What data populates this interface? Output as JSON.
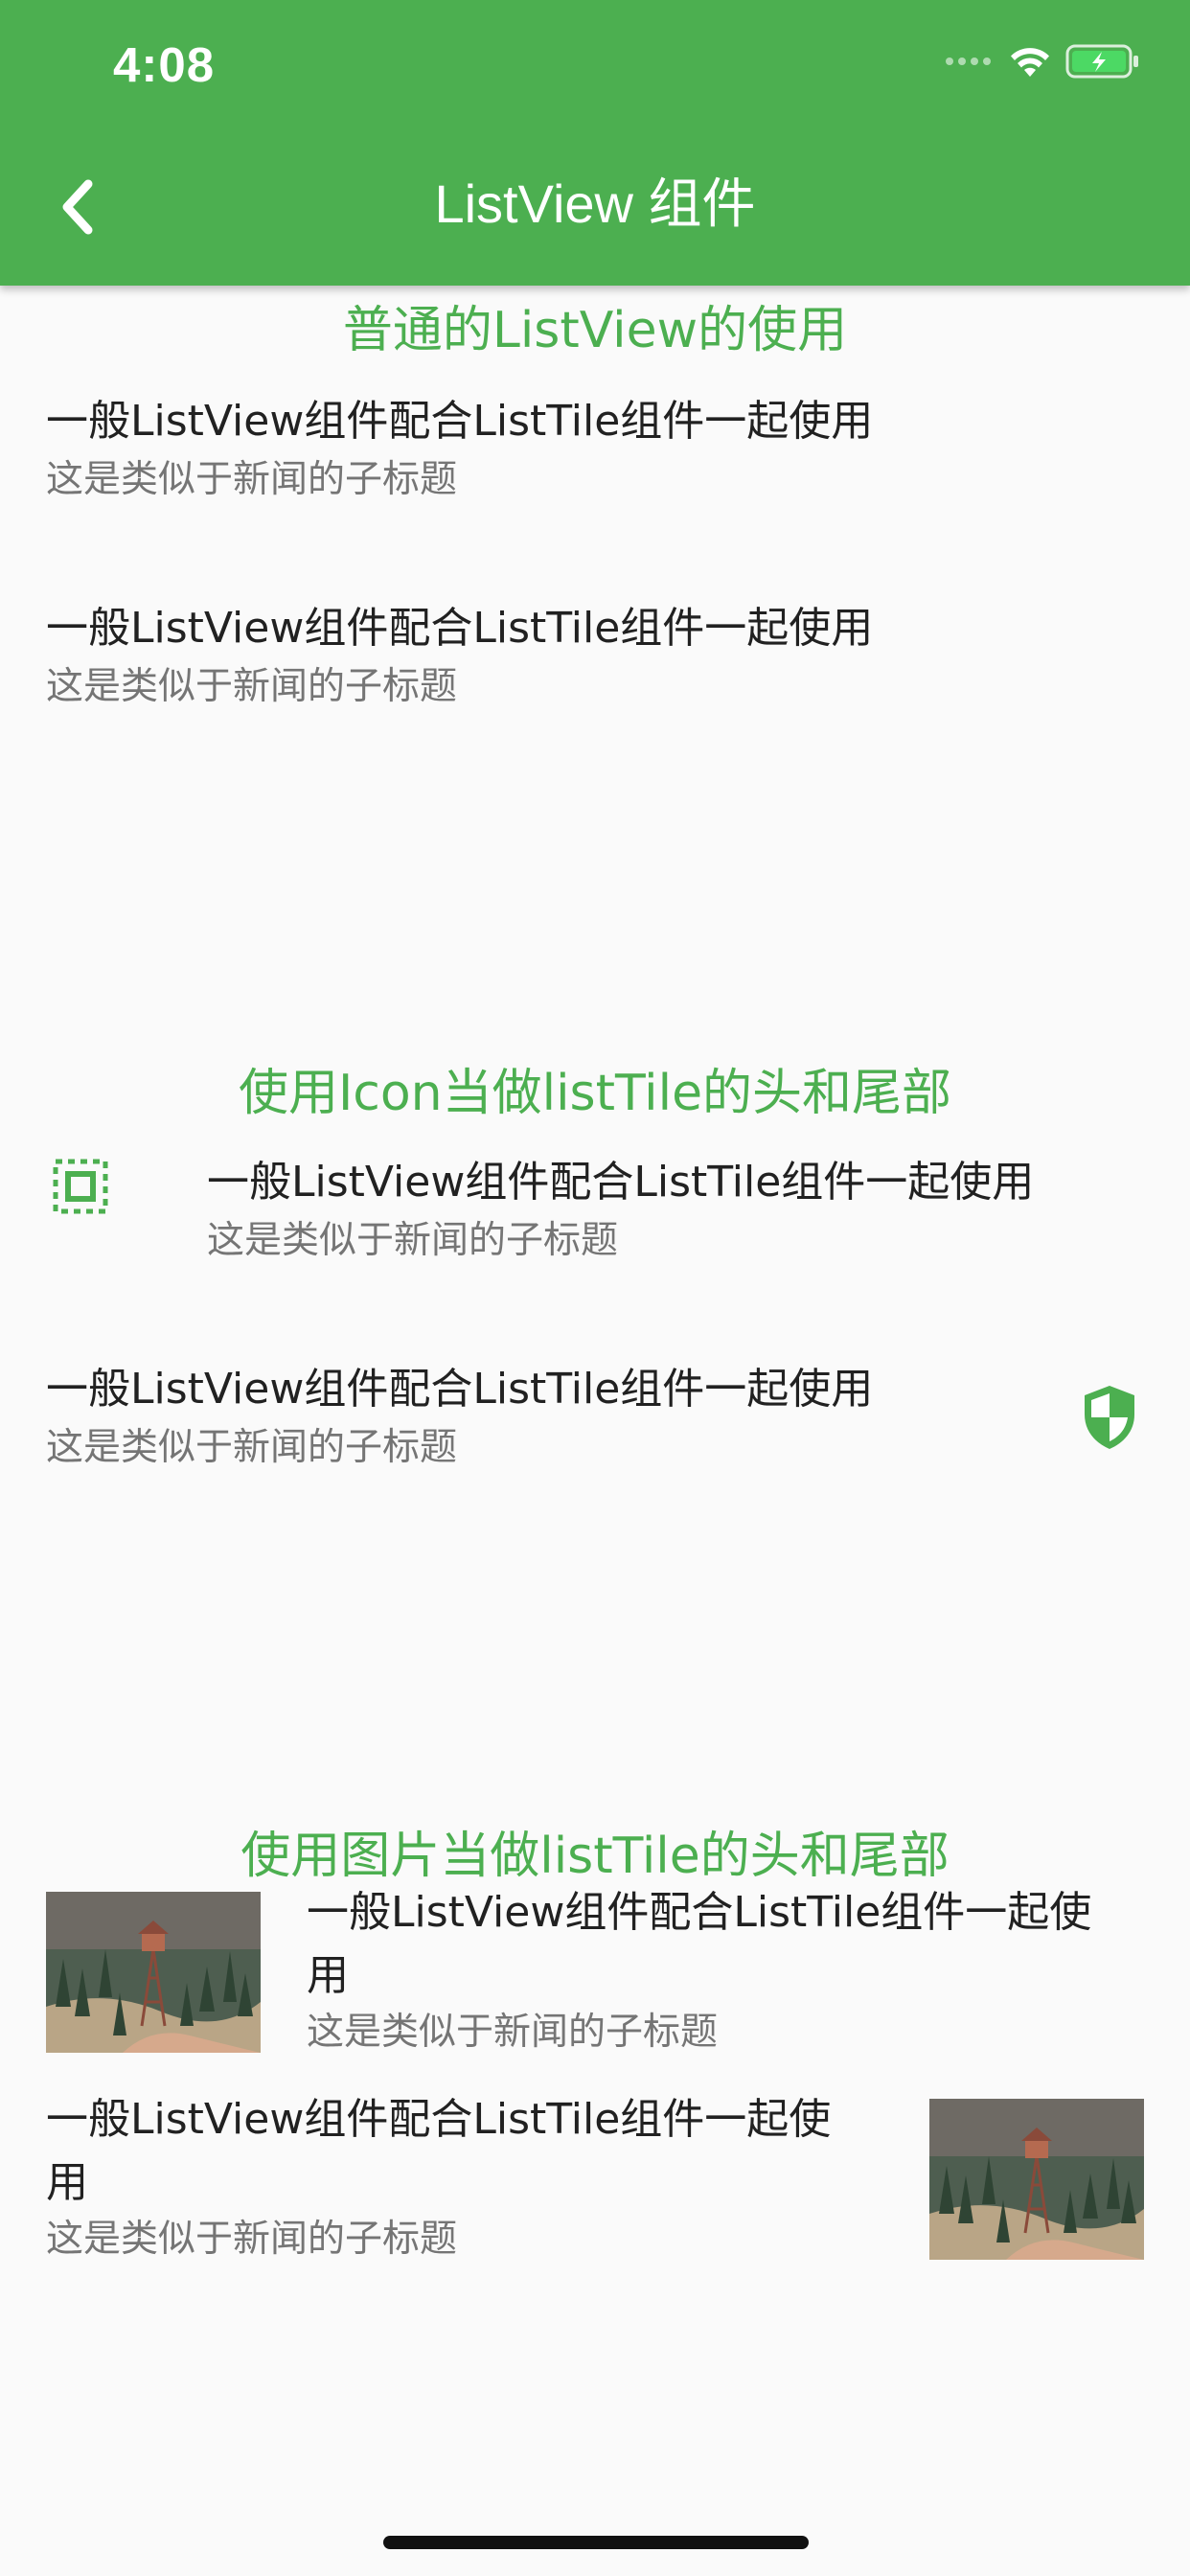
{
  "status": {
    "time": "4:08"
  },
  "appbar": {
    "title": "ListView 组件",
    "color": "#4caf50"
  },
  "sections": [
    {
      "title": "普通的ListView的使用",
      "tiles": [
        {
          "title": "一般ListView组件配合ListTile组件一起使用",
          "subtitle": "这是类似于新闻的子标题"
        },
        {
          "title": "一般ListView组件配合ListTile组件一起使用",
          "subtitle": "这是类似于新闻的子标题"
        }
      ]
    },
    {
      "title": "使用Icon当做listTile的头和尾部",
      "tiles": [
        {
          "title": "一般ListView组件配合ListTile组件一起使用",
          "subtitle": "这是类似于新闻的子标题",
          "leading_icon": "settings-overscan-icon"
        },
        {
          "title": "一般ListView组件配合ListTile组件一起使用",
          "subtitle": "这是类似于新闻的子标题",
          "trailing_icon": "shield-icon"
        }
      ]
    },
    {
      "title": "使用图片当做listTile的头和尾部",
      "tiles": [
        {
          "title_line1": "一般ListView组件配合ListTile组件一起使",
          "title_line2": "用",
          "subtitle": "这是类似于新闻的子标题",
          "leading_image": "forest-watchtower-image"
        },
        {
          "title_line1": "一般ListView组件配合ListTile组件一起使",
          "title_line2": "用",
          "subtitle": "这是类似于新闻的子标题",
          "trailing_image": "forest-watchtower-image"
        }
      ]
    }
  ]
}
